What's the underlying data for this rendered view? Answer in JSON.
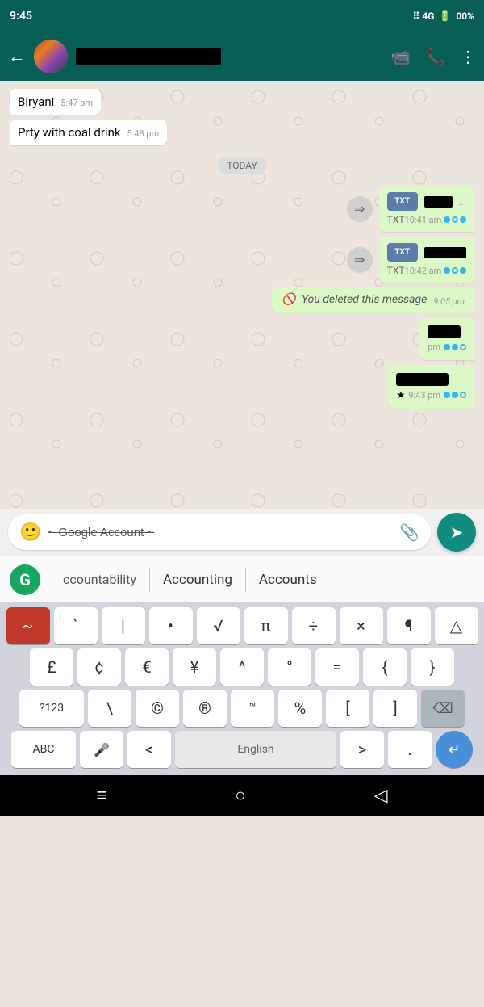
{
  "statusBar": {
    "time": "9:45",
    "signal": "||||",
    "network": "4G",
    "battery": "00%"
  },
  "header": {
    "backLabel": "←",
    "videoCallIcon": "📹",
    "callIcon": "📞",
    "menuIcon": "⋮"
  },
  "chat": {
    "messages": [
      {
        "id": 1,
        "type": "received",
        "text": "Biryani",
        "time": "5:47 pm"
      },
      {
        "id": 2,
        "type": "received",
        "text": "Prty with coal drink",
        "time": "5:48 pm"
      },
      {
        "id": 3,
        "type": "divider",
        "text": "TODAY"
      },
      {
        "id": 4,
        "type": "file-sent",
        "fileType": "TXT",
        "time": "10:41 am"
      },
      {
        "id": 5,
        "type": "file-sent",
        "fileType": "TXT",
        "time": "10:42 am"
      },
      {
        "id": 6,
        "type": "deleted",
        "text": "You deleted this message",
        "time": "9:05 pm"
      },
      {
        "id": 7,
        "type": "redacted",
        "time": "pm"
      },
      {
        "id": 8,
        "type": "redacted-star",
        "time": "9:43 pm"
      }
    ]
  },
  "inputArea": {
    "emojiIcon": "🙂",
    "inputText": "~ Google Account ~",
    "attachIcon": "📎",
    "sendIcon": "➤"
  },
  "autocomplete": {
    "grammarlyLetter": "G",
    "words": [
      "ccountability",
      "Accounting",
      "Accounts"
    ]
  },
  "keyboard": {
    "row1": [
      "~",
      "`",
      "|",
      "•",
      "√",
      "π",
      "÷",
      "×",
      "¶",
      "△"
    ],
    "row2": [
      "£",
      "¢",
      "€",
      "¥",
      "^",
      "°",
      "=",
      "{",
      "}"
    ],
    "row3Left": "?123",
    "row3": [
      "\\",
      "©",
      "®",
      "™",
      "%",
      "[",
      "]"
    ],
    "row3Right": "⌫",
    "row4Left": "ABC",
    "row4LeftSub": "🎤",
    "row4LeftAngle": "<",
    "spaceLabel": "English",
    "row4RightAngle": ">",
    "row4RightDot": ".",
    "enterIcon": "↵"
  },
  "navBar": {
    "menuIcon": "≡",
    "homeIcon": "○",
    "backIcon": "◁"
  }
}
